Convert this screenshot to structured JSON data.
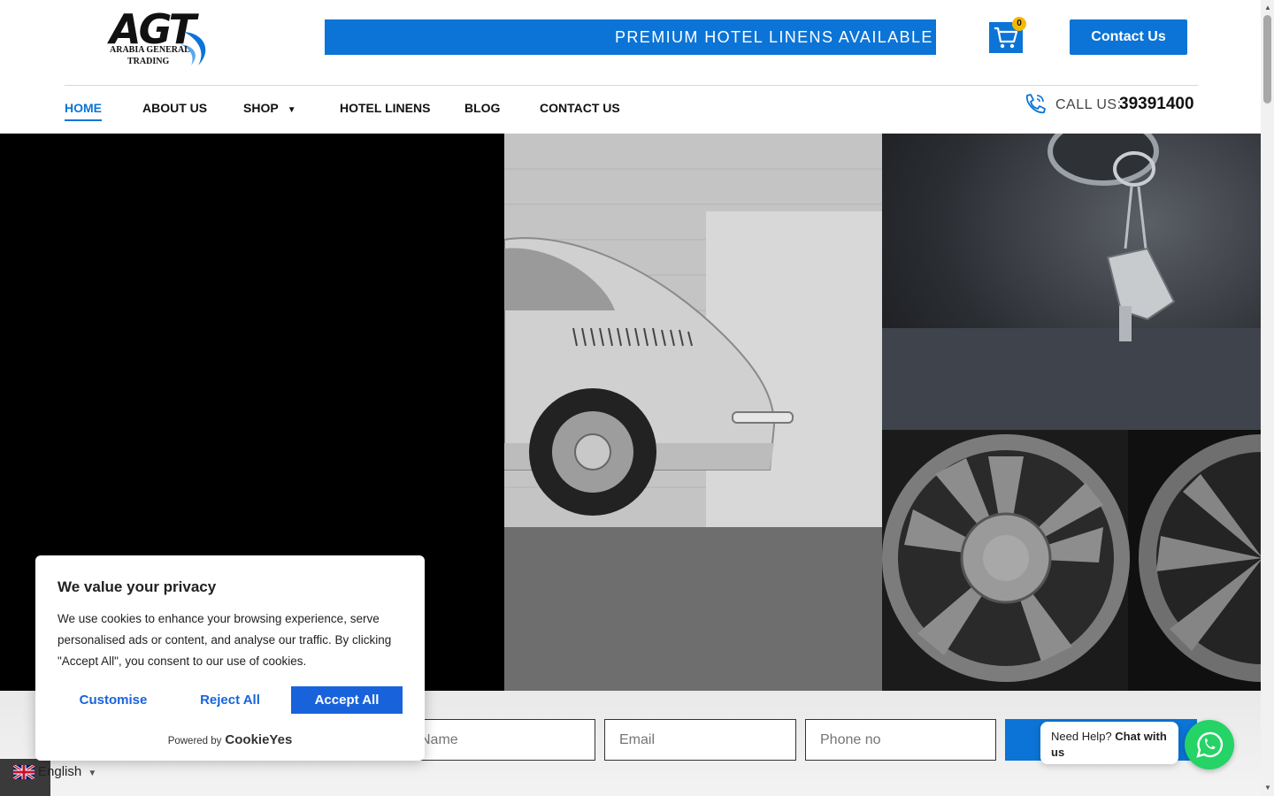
{
  "brand": {
    "logo_mark": "AGT",
    "logo_line1": "ARABIA GENERAL",
    "logo_line2": "TRADING"
  },
  "ticker": {
    "text": "PREMIUM HOTEL LINENS AVAILABLE -"
  },
  "cart": {
    "count": "0"
  },
  "header": {
    "contact_label": "Contact Us"
  },
  "nav": {
    "home": "HOME",
    "about": "ABOUT US",
    "shop": "SHOP",
    "hotel_linens": "HOTEL LINENS",
    "blog": "BLOG",
    "contact": "CONTACT US"
  },
  "call": {
    "label": "CALL US:",
    "number": "39391400"
  },
  "form": {
    "name_placeholder": "Name",
    "email_placeholder": "Email",
    "phone_placeholder": "Phone no"
  },
  "language": {
    "current": "English"
  },
  "whatsapp": {
    "prompt": "Need Help?",
    "action": "Chat with us"
  },
  "cookie": {
    "title": "We value your privacy",
    "text": "We use cookies to enhance your browsing experience, serve personalised ads or content, and analyse our traffic. By clicking \"Accept All\", you consent to our use of cookies.",
    "customise": "Customise",
    "reject": "Reject All",
    "accept": "Accept All",
    "powered_by": "Powered by",
    "powered_brand": "CookieYes"
  },
  "colors": {
    "brand_blue": "#0b74d6",
    "cookie_blue": "#1863dc",
    "whatsapp_green": "#25d366"
  }
}
